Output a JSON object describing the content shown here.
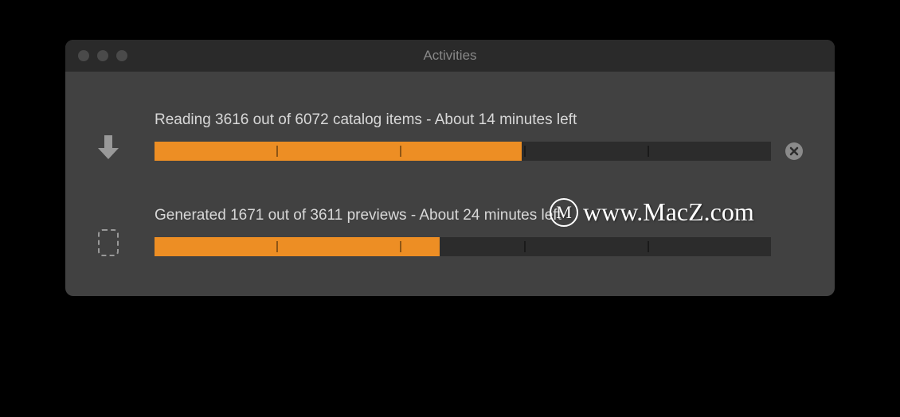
{
  "window": {
    "title": "Activities"
  },
  "activities": [
    {
      "icon": "download-arrow-icon",
      "label": "Reading 3616 out of 6072 catalog items - About 14 minutes left",
      "progress_percent": 59.6,
      "cancellable": true
    },
    {
      "icon": "dashed-rect-icon",
      "label": "Generated 1671 out of 3611 previews - About 24 minutes left",
      "progress_percent": 46.3,
      "cancellable": false
    }
  ],
  "colors": {
    "accent": "#ed8e24",
    "window_bg": "#414141",
    "titlebar_bg": "#2a2a2a",
    "progress_track": "#2c2c2c"
  },
  "watermark": {
    "logo_letter": "M",
    "text": "www.MacZ.com"
  }
}
